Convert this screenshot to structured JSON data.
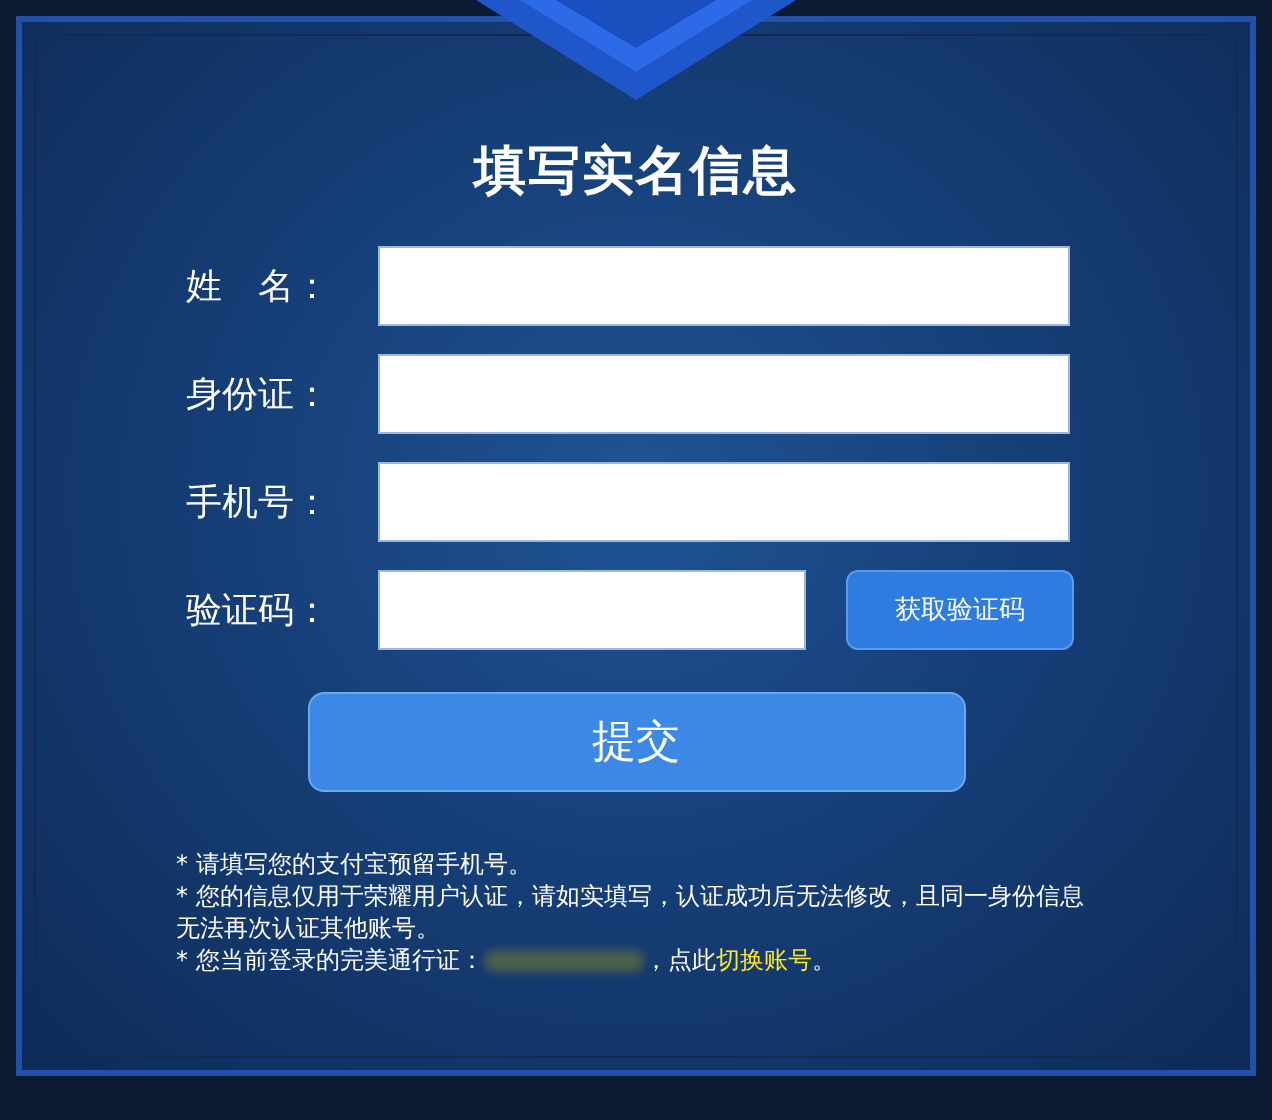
{
  "title": "填写实名信息",
  "fields": [
    {
      "label": "姓　名：",
      "kind": "text"
    },
    {
      "label": "身份证：",
      "kind": "text"
    },
    {
      "label": "手机号：",
      "kind": "text"
    },
    {
      "label": "验证码：",
      "kind": "code",
      "button": "获取验证码"
    }
  ],
  "submit": "提交",
  "notes": [
    {
      "text": "* 请填写您的支付宝预留手机号。"
    },
    {
      "text": "* 您的信息仅用于荣耀用户认证，请如实填写，认证成功后无法修改，且同一身份信息无法再次认证其他账号。"
    },
    {
      "text": "* 您当前登录的完美通行证：",
      "redacted": true,
      "after": "，点此",
      "link": "切换账号",
      "end": "。"
    }
  ]
}
